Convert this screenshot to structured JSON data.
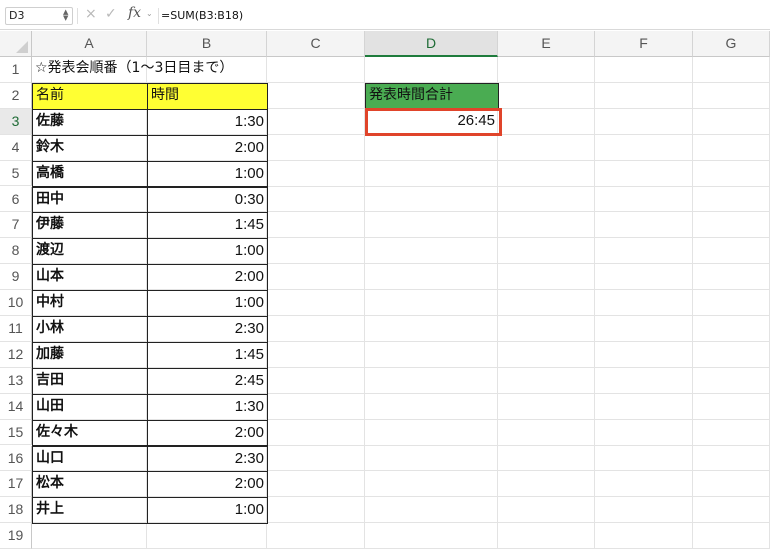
{
  "formula_bar": {
    "name_box": "D3",
    "cancel_icon": "×",
    "enter_icon": "✓",
    "fx_label": "fx",
    "formula": "=SUM(B3:B18)"
  },
  "columns": [
    "A",
    "B",
    "C",
    "D",
    "E",
    "F",
    "G"
  ],
  "selected_column": "D",
  "rows": [
    "1",
    "2",
    "3",
    "4",
    "5",
    "6",
    "7",
    "8",
    "9",
    "10",
    "11",
    "12",
    "13",
    "14",
    "15",
    "16",
    "17",
    "18",
    "19"
  ],
  "selected_row": "3",
  "sheet": {
    "title": "☆発表会順番（1〜3日目まで）",
    "header_name": "名前",
    "header_time": "時間",
    "records": [
      {
        "name": "佐藤",
        "time": "1:30"
      },
      {
        "name": "鈴木",
        "time": "2:00"
      },
      {
        "name": "高橋",
        "time": "1:00"
      },
      {
        "name": "田中",
        "time": "0:30"
      },
      {
        "name": "伊藤",
        "time": "1:45"
      },
      {
        "name": "渡辺",
        "time": "1:00"
      },
      {
        "name": "山本",
        "time": "2:00"
      },
      {
        "name": "中村",
        "time": "1:00"
      },
      {
        "name": "小林",
        "time": "2:30"
      },
      {
        "name": "加藤",
        "time": "1:45"
      },
      {
        "name": "吉田",
        "time": "2:45"
      },
      {
        "name": "山田",
        "time": "1:30"
      },
      {
        "name": "佐々木",
        "time": "2:00"
      },
      {
        "name": "山口",
        "time": "2:30"
      },
      {
        "name": "松本",
        "time": "2:00"
      },
      {
        "name": "井上",
        "time": "1:00"
      }
    ],
    "total_label": "発表時間合計",
    "total_value": "26:45"
  },
  "colors": {
    "header_yellow": "#ffff33",
    "total_green": "#4aac52",
    "selection_red": "#e0442a"
  }
}
